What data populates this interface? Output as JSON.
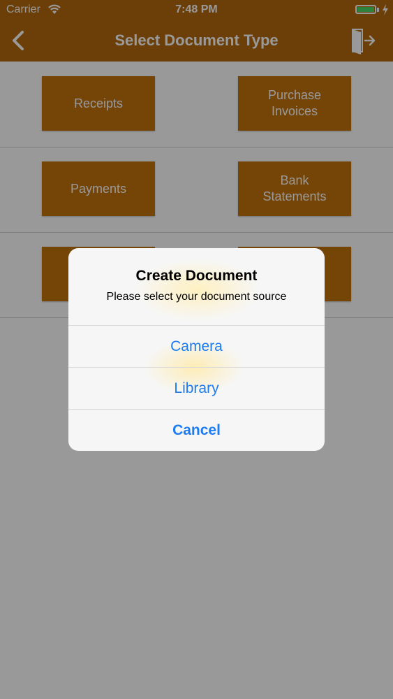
{
  "status_bar": {
    "carrier": "Carrier",
    "time": "7:48 PM",
    "battery_color": "#4cd964"
  },
  "nav": {
    "title": "Select Document Type",
    "back_icon": "chevron-left-icon",
    "exit_icon": "exit-door-icon",
    "color": "#b66a0e"
  },
  "documents": {
    "receipts": "Receipts",
    "purchase_invoices": "Purchase\nInvoices",
    "payments": "Payments",
    "bank_statements": "Bank\nStatements"
  },
  "alert": {
    "title": "Create Document",
    "message": "Please select your document source",
    "buttons": {
      "camera": "Camera",
      "library": "Library",
      "cancel": "Cancel"
    },
    "button_color": "#1d7cf2"
  }
}
